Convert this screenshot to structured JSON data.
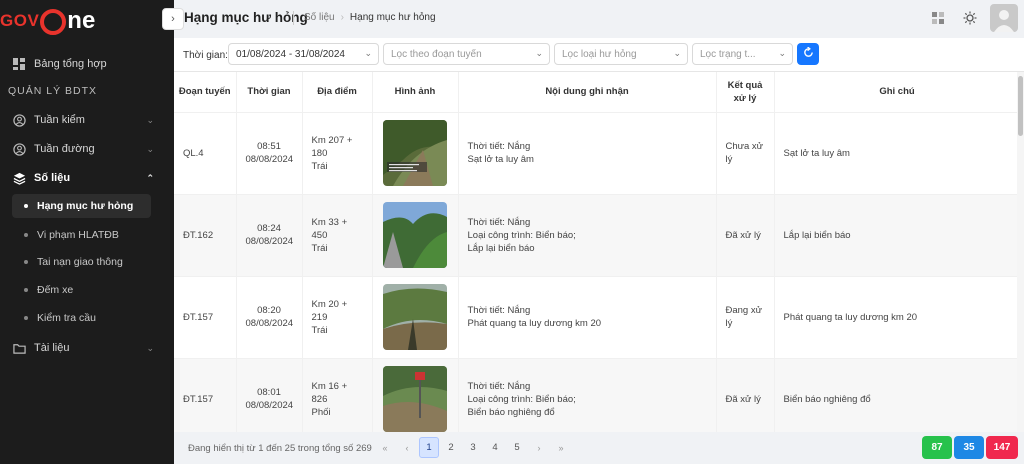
{
  "brand": {
    "part1": "GOV",
    "part2": "ne"
  },
  "sidebar": {
    "dashboard": "Bảng tổng hợp",
    "section": "QUẢN LÝ BDTX",
    "groups": [
      {
        "label": "Tuần kiểm"
      },
      {
        "label": "Tuần đường"
      },
      {
        "label": "Số liệu"
      },
      {
        "label": "Tài liệu"
      }
    ],
    "sub_items": [
      {
        "label": "Hạng mục hư hỏng"
      },
      {
        "label": "Vi phạm HLATĐB"
      },
      {
        "label": "Tai nạn giao thông"
      },
      {
        "label": "Đếm xe"
      },
      {
        "label": "Kiểm tra cầu"
      }
    ]
  },
  "header": {
    "title": "Hạng mục hư hỏng",
    "breadcrumb": [
      "Số liệu",
      "Hạng mục hư hỏng"
    ]
  },
  "filters": {
    "time_label": "Thời gian:",
    "date_range": "01/08/2024 - 31/08/2024",
    "route_placeholder": "Lọc theo đoạn tuyến",
    "type_placeholder": "Lọc loại hư hỏng",
    "status_placeholder": "Lọc trạng t..."
  },
  "table": {
    "columns": [
      "Đoạn tuyến",
      "Thời gian",
      "Địa điểm",
      "Hình ảnh",
      "Nội dung ghi nhận",
      "Kết quả xử lý",
      "Ghi chú"
    ],
    "rows": [
      {
        "route": "QL.4",
        "time": "08:51",
        "date": "08/08/2024",
        "loc1": "Km 207 +",
        "loc2": "180",
        "loc3": "Trái",
        "c1": "Thời tiết: Nắng",
        "c2": "Sạt lở ta luy âm",
        "c3": "",
        "r1": "Chưa xử",
        "r2": "lý",
        "note": "Sạt lở ta luy âm"
      },
      {
        "route": "ĐT.162",
        "time": "08:24",
        "date": "08/08/2024",
        "loc1": "Km 33 +",
        "loc2": "450",
        "loc3": "Trái",
        "c1": "Thời tiết: Nắng",
        "c2": "Loại công trình: Biển báo;",
        "c3": "Lắp lại biển báo",
        "r1": "Đã xử lý",
        "r2": "",
        "note": "Lắp lại biển báo"
      },
      {
        "route": "ĐT.157",
        "time": "08:20",
        "date": "08/08/2024",
        "loc1": "Km 20 + 219",
        "loc2": "Trái",
        "loc3": "",
        "c1": "Thời tiết: Nắng",
        "c2": "Phát quang ta luy dương km 20",
        "c3": "",
        "r1": "Đang xử",
        "r2": "lý",
        "note": "Phát quang ta luy dương km 20"
      },
      {
        "route": "ĐT.157",
        "time": "08:01",
        "date": "08/08/2024",
        "loc1": "Km 16 + 826",
        "loc2": "Phối",
        "loc3": "",
        "c1": "Thời tiết: Nắng",
        "c2": "Loại công trình: Biển báo;",
        "c3": "Biển báo nghiêng đổ",
        "r1": "Đã xử lý",
        "r2": "",
        "note": "Biển báo nghiêng đổ"
      }
    ]
  },
  "footer": {
    "summary": "Đang hiển thị từ 1 đến 25 trong tổng số 269",
    "pages": [
      "1",
      "2",
      "3",
      "4",
      "5"
    ],
    "badges": [
      {
        "value": "87",
        "color": "#27c24c"
      },
      {
        "value": "35",
        "color": "#1e88e5"
      },
      {
        "value": "147",
        "color": "#f0284e"
      }
    ]
  },
  "colors": {
    "brand": "#e8332c",
    "sidebar_bg": "#1c1c1c",
    "primary": "#1677ff"
  },
  "icons": [
    "grid-icon",
    "user-icon",
    "layers-icon",
    "folder-icon",
    "chevron-icon",
    "sun-icon",
    "refresh-icon",
    "calendar-icon"
  ]
}
